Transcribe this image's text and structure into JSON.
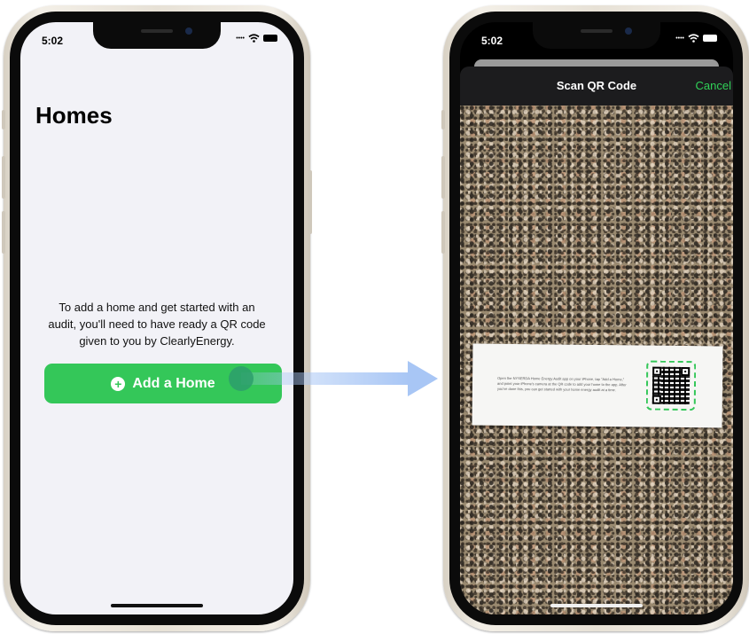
{
  "left_screen": {
    "status": {
      "time": "5:02"
    },
    "title": "Homes",
    "intro_text": "To add a home and get started with an audit, you'll need to have ready a QR code given to you by ClearlyEnergy.",
    "add_button": {
      "label": "Add a Home",
      "icon": "plus-circle-icon"
    }
  },
  "right_screen": {
    "status": {
      "time": "5:02"
    },
    "modal": {
      "title": "Scan QR Code",
      "cancel_label": "Cancel"
    },
    "paper_text": "Open the NYSERDA Home Energy Audit app on your iPhone, tap \"Add a Home,\" and point your iPhone's camera at the QR code to add your home to the app. After you've done this, you can get started with your home energy audit at a time."
  },
  "colors": {
    "accent_green": "#34c759",
    "cancel_green": "#30d158",
    "arrow_blue": "#a8c6f5"
  }
}
